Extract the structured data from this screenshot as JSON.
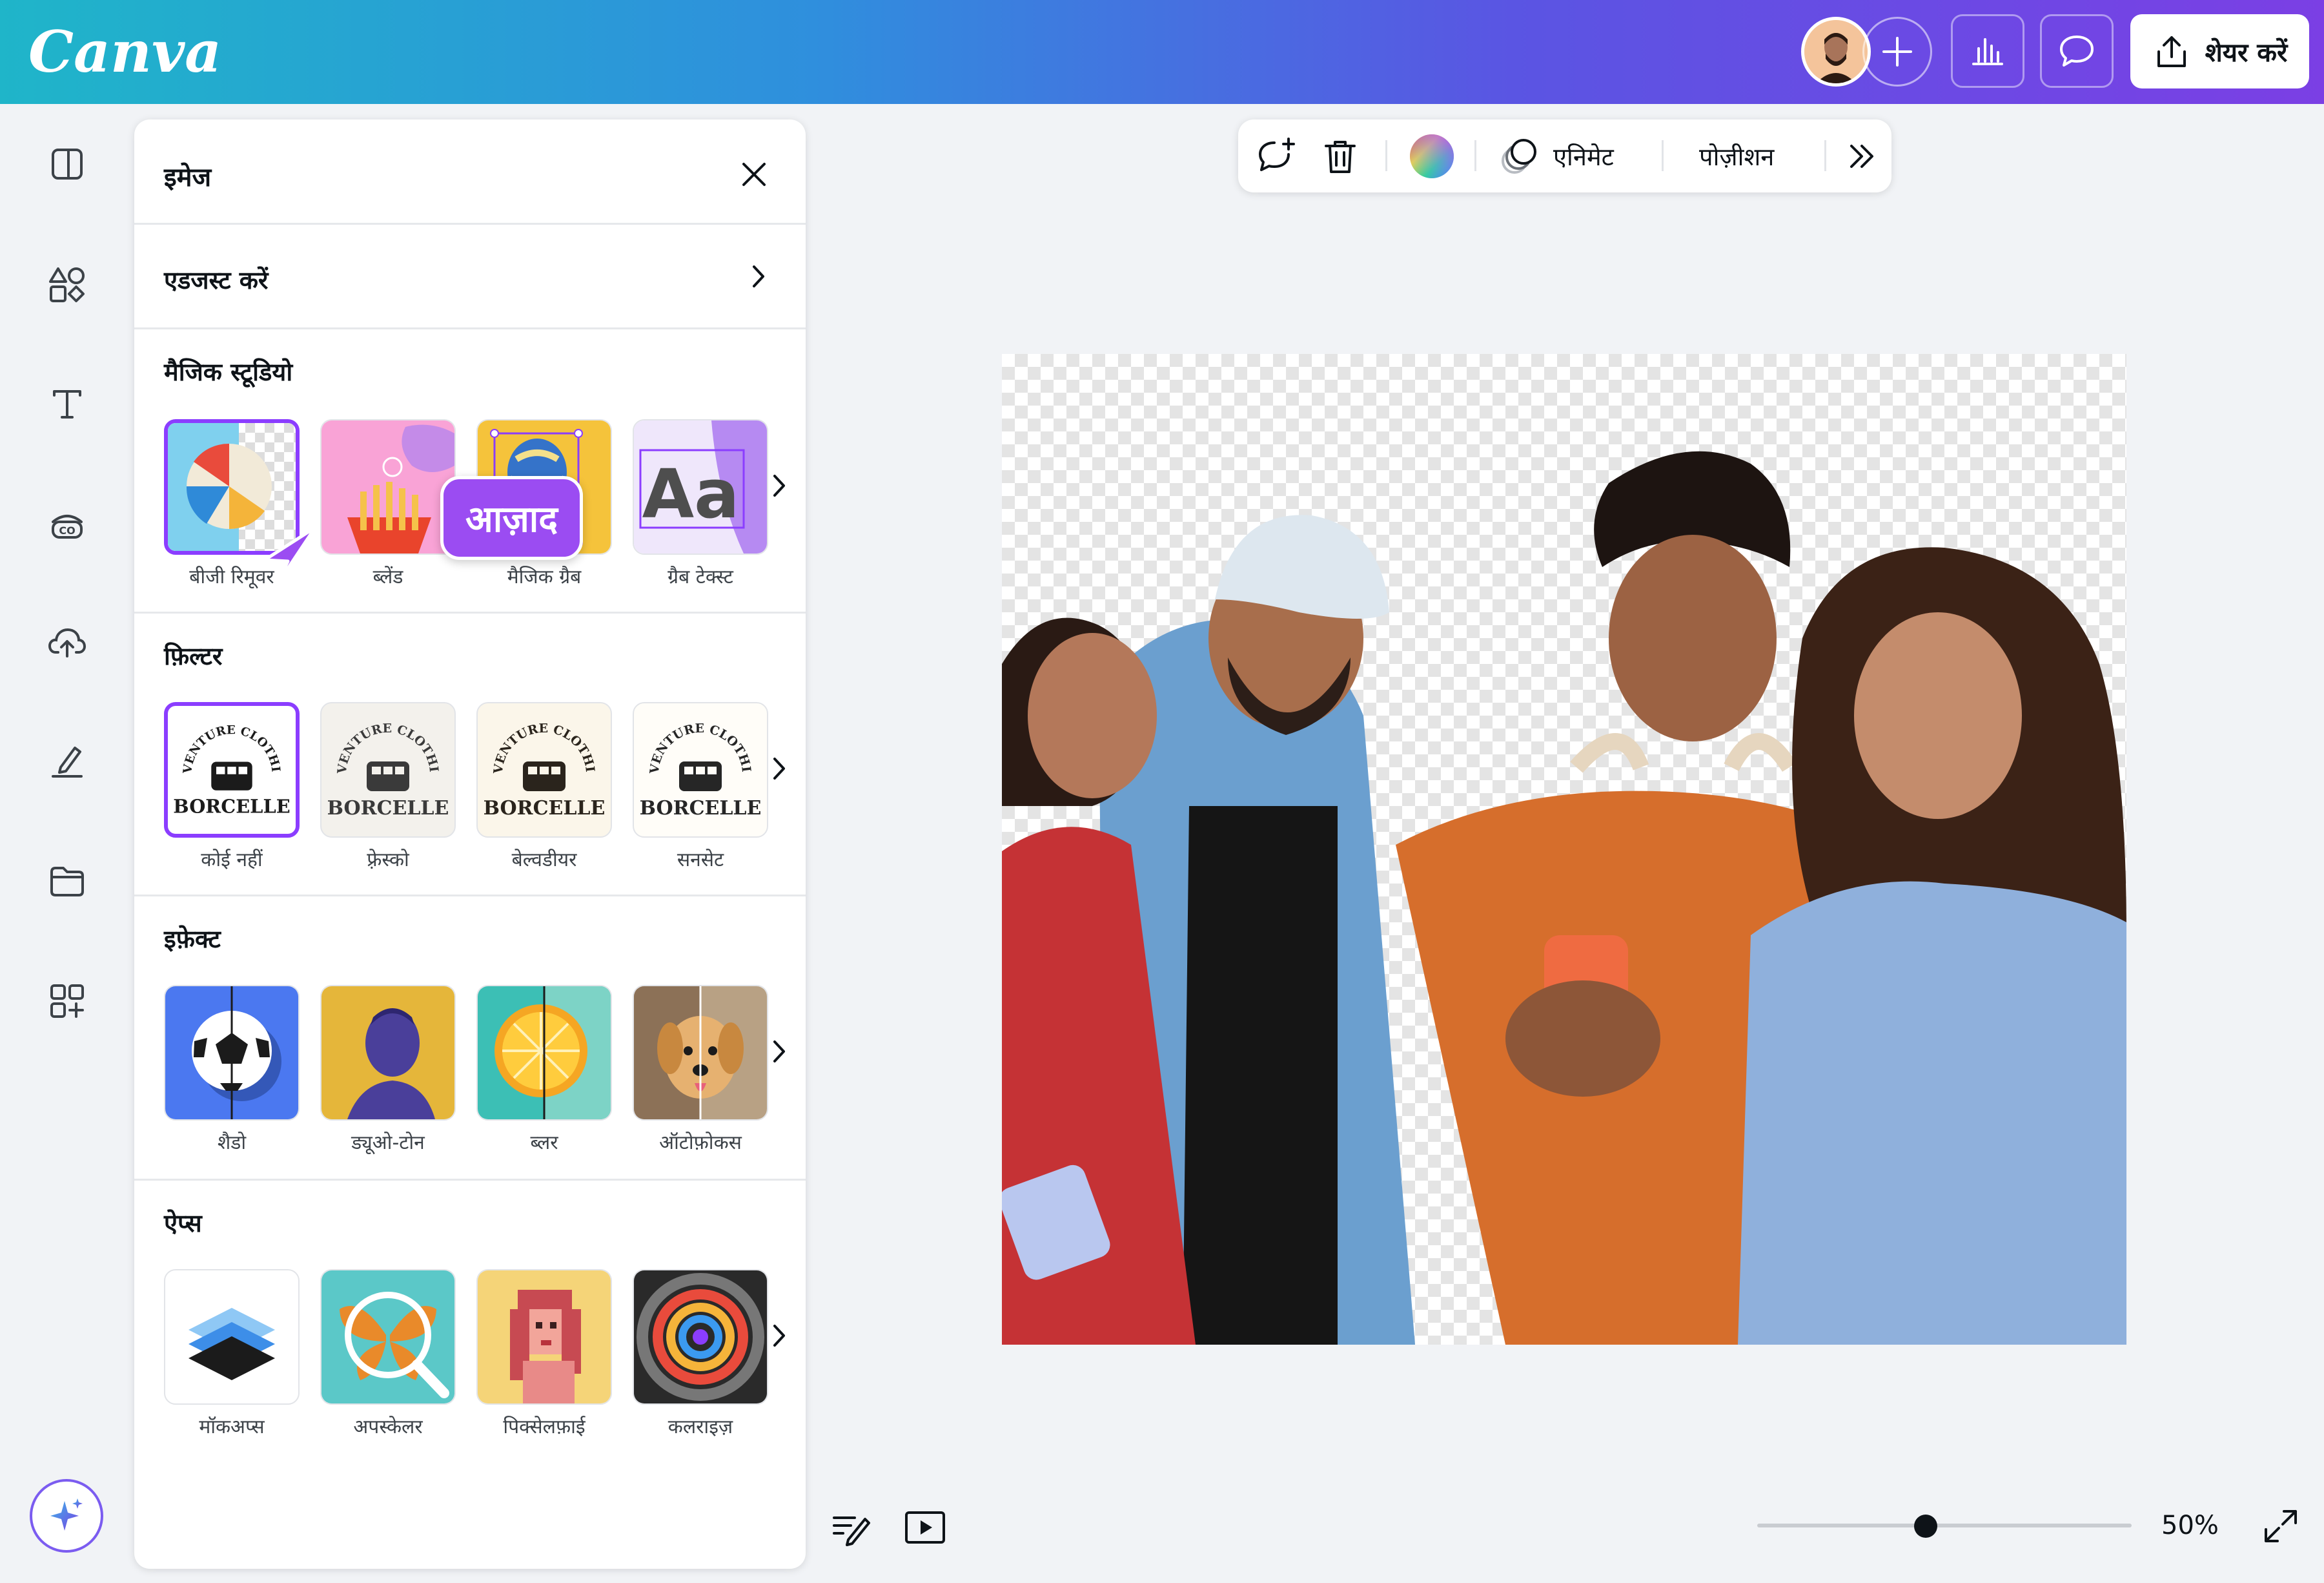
{
  "header": {
    "logo": "Canva",
    "share_label": "शेयर करें",
    "icons": [
      "user-avatar",
      "plus-icon",
      "insights-icon",
      "comment-icon",
      "share-upload-icon"
    ]
  },
  "rail": {
    "icons": [
      "design-icon",
      "elements-icon",
      "text-icon",
      "brand-icon",
      "uploads-icon",
      "draw-icon",
      "projects-icon",
      "apps-icon",
      "magic-sparkle-icon"
    ]
  },
  "panel": {
    "title": "इमेज",
    "adjust_label": "एडजस्ट करें",
    "magic_studio": {
      "title": "मैजिक स्टूडियो",
      "badge": "आज़ाद",
      "items": [
        {
          "label": "बीजी रिमूवर"
        },
        {
          "label": "ब्लेंड"
        },
        {
          "label": "मैजिक ग्रैब"
        },
        {
          "label": "ग्रैब टेक्स्ट",
          "art": "Aa"
        }
      ]
    },
    "filters": {
      "title": "फ़िल्टर",
      "logo_text": "BORCELLE",
      "logo_arc": "ADVENTURE CLOTHING",
      "items": [
        {
          "label": "कोई नहीं"
        },
        {
          "label": "फ़्रेस्को"
        },
        {
          "label": "बेल्वडीयर"
        },
        {
          "label": "सनसेट"
        }
      ]
    },
    "effects": {
      "title": "इफ़ेक्ट",
      "items": [
        {
          "label": "शैडो"
        },
        {
          "label": "ड्यूओ-टोन"
        },
        {
          "label": "ब्लर"
        },
        {
          "label": "ऑटोफ़ोकस"
        }
      ]
    },
    "apps": {
      "title": "ऐप्स",
      "items": [
        {
          "label": "मॉकअप्स"
        },
        {
          "label": "अपस्केलर"
        },
        {
          "label": "पिक्सेलफ़ाई"
        },
        {
          "label": "कलराइज़"
        }
      ]
    }
  },
  "toolbar": {
    "animate_label": "एनिमेट",
    "position_label": "पोज़ीशन"
  },
  "footer": {
    "zoom_label": "50%",
    "zoom_fraction": 0.45
  },
  "colors": {
    "accent": "#8b3dff",
    "header_start": "#1fb5c9",
    "header_end": "#7b3fe4"
  }
}
